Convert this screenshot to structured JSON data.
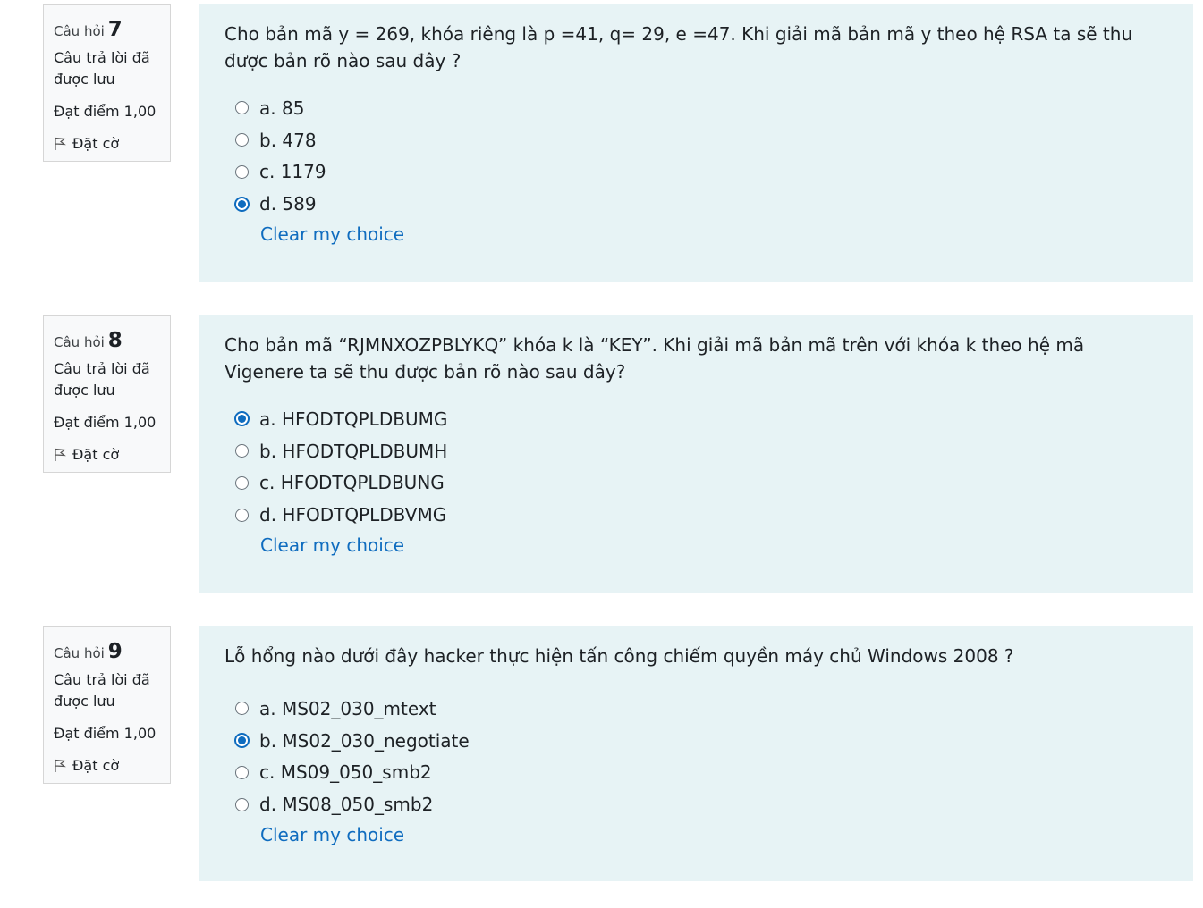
{
  "questions": [
    {
      "label": "Câu hỏi",
      "number": "7",
      "state": "Câu trả lời đã được lưu",
      "grade": "Đạt điểm 1,00",
      "flag": "Đặt cờ",
      "text": "Cho bản mã y = 269, khóa riêng là p =41, q= 29, e =47. Khi giải mã bản mã y theo hệ RSA ta sẽ thu được bản rõ nào sau đây ?",
      "answers": [
        {
          "label": "a. 85",
          "checked": false
        },
        {
          "label": "b. 478",
          "checked": false
        },
        {
          "label": "c. 1179",
          "checked": false
        },
        {
          "label": "d. 589",
          "checked": true
        }
      ],
      "clear_label": "Clear my choice"
    },
    {
      "label": "Câu hỏi",
      "number": "8",
      "state": "Câu trả lời đã được lưu",
      "grade": "Đạt điểm 1,00",
      "flag": "Đặt cờ",
      "text": "Cho bản mã “RJMNXOZPBLYKQ” khóa k là “KEY”. Khi giải mã bản mã trên với khóa k theo hệ mã Vigenere ta sẽ thu được bản rõ nào sau đây?",
      "answers": [
        {
          "label": "a. HFODTQPLDBUMG",
          "checked": true
        },
        {
          "label": "b. HFODTQPLDBUMH",
          "checked": false
        },
        {
          "label": "c. HFODTQPLDBUNG",
          "checked": false
        },
        {
          "label": "d. HFODTQPLDBVMG",
          "checked": false
        }
      ],
      "clear_label": "Clear my choice"
    },
    {
      "label": "Câu hỏi",
      "number": "9",
      "state": "Câu trả lời đã được lưu",
      "grade": "Đạt điểm 1,00",
      "flag": "Đặt cờ",
      "text": "Lỗ hổng nào dưới đây hacker thực hiện tấn công chiếm quyền máy chủ Windows 2008 ?",
      "answers": [
        {
          "label": "a. MS02_030_mtext",
          "checked": false
        },
        {
          "label": "b. MS02_030_negotiate",
          "checked": true
        },
        {
          "label": "c. MS09_050_smb2",
          "checked": false
        },
        {
          "label": "d. MS08_050_smb2",
          "checked": false
        }
      ],
      "clear_label": "Clear my choice"
    }
  ],
  "colors": {
    "content_bg": "#e7f3f5",
    "info_bg": "#f8f9fa",
    "link": "#0f6cbf",
    "radio_checked": "#0f6cbf"
  },
  "icons": {
    "flag": "flag-icon"
  }
}
